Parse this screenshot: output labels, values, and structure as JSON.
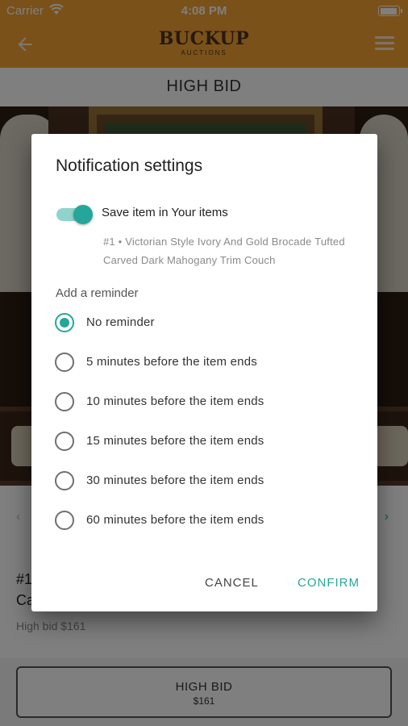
{
  "status_bar": {
    "carrier": "Carrier",
    "time": "4:08 PM"
  },
  "app_bar": {
    "logo_main": "BUCKUP",
    "logo_sub": "AUCTIONS",
    "color": "#f4a332"
  },
  "page": {
    "title": "HIGH BID"
  },
  "item": {
    "lot_line1": "#1",
    "lot_line2": "Ca",
    "high_bid_text": "High bid $161",
    "bid_button_label": "HIGH BID",
    "bid_button_value": "$161"
  },
  "dialog": {
    "title": "Notification settings",
    "save_toggle": {
      "label": "Save item in Your items",
      "on": true
    },
    "item_description": "#1 • Victorian Style Ivory And Gold Brocade Tufted Carved Dark Mahogany Trim Couch",
    "reminder_heading": "Add a reminder",
    "options": [
      {
        "label": "No reminder",
        "selected": true
      },
      {
        "label": "5 minutes before the item ends",
        "selected": false
      },
      {
        "label": "10 minutes before the item ends",
        "selected": false
      },
      {
        "label": "15 minutes before the item ends",
        "selected": false
      },
      {
        "label": "30 minutes before the item ends",
        "selected": false
      },
      {
        "label": "60 minutes before the item ends",
        "selected": false
      }
    ],
    "cancel_label": "CANCEL",
    "confirm_label": "CONFIRM",
    "accent_color": "#26a69a"
  }
}
